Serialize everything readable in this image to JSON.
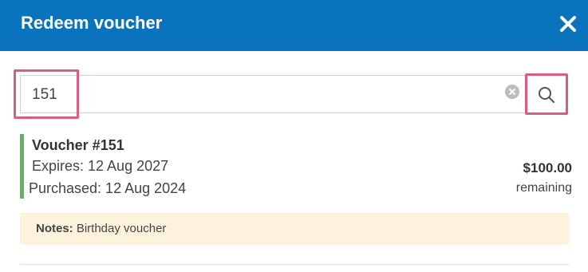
{
  "dialog": {
    "title": "Redeem voucher",
    "close_icon": "close-icon"
  },
  "search": {
    "value": "151",
    "placeholder": "",
    "clear_icon": "clear-icon",
    "search_icon": "search-icon"
  },
  "voucher": {
    "name": "Voucher #151",
    "expires": "Expires: 12 Aug 2027",
    "purchased": "Purchased: 12 Aug 2024",
    "amount": "$100.00",
    "amount_label": "remaining",
    "status_color": "#5cb85c"
  },
  "notes": {
    "label": "Notes:",
    "text": "Birthday voucher"
  },
  "colors": {
    "header": "#0a73be",
    "highlight": "#d95d85",
    "notes_background": "#fdf3dc"
  }
}
